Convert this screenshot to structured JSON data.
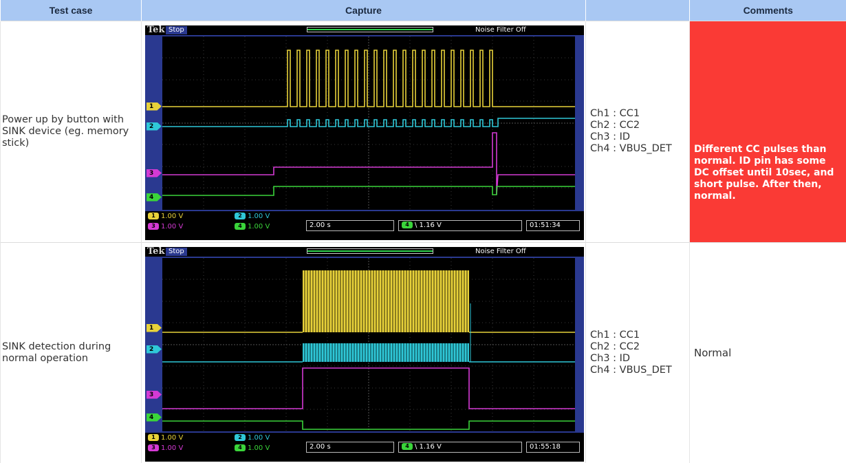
{
  "header": {
    "col1": "Test case",
    "col2": "Capture",
    "col3": "",
    "col4": "Comments"
  },
  "rows": [
    {
      "test_case": "Power up by button with SINK device (eg. memory stick)",
      "scope": {
        "brand": "Tek",
        "state": "Stop",
        "noise_filter": "Noise Filter Off",
        "ch1_scale": "1.00 V",
        "ch2_scale": "1.00 V",
        "ch3_scale": "1.00 V",
        "ch4_scale": "1.00 V",
        "timebase": "2.00 s",
        "trigger": "\\ 1.16 V",
        "clock": "01:51:34"
      },
      "channels": [
        "Ch1 : CC1",
        "Ch2 : CC2",
        "Ch3 : ID",
        "Ch4 : VBUS_DET"
      ],
      "comment": "Different CC pulses than normal. ID pin has some DC offset until 10sec, and short pulse. After then, normal.",
      "comment_highlight": "#fa3a35"
    },
    {
      "test_case": "SINK detection during normal operation",
      "scope": {
        "brand": "Tek",
        "state": "Stop",
        "noise_filter": "Noise Filter Off",
        "ch1_scale": "1.00 V",
        "ch2_scale": "1.00 V",
        "ch3_scale": "1.00 V",
        "ch4_scale": "1.00 V",
        "timebase": "2.00 s",
        "trigger": "\\ 1.16 V",
        "clock": "01:55:18"
      },
      "channels": [
        "Ch1 : CC1",
        "Ch2 : CC2",
        "Ch3 : ID",
        "Ch4 : VBUS_DET"
      ],
      "comment": "Normal"
    }
  ],
  "colors": {
    "header_bg": "#a9c8f3",
    "ch1": "#e8d23a",
    "ch2": "#2fc8d8",
    "ch3": "#d43ad4",
    "ch4": "#3ad43a"
  }
}
